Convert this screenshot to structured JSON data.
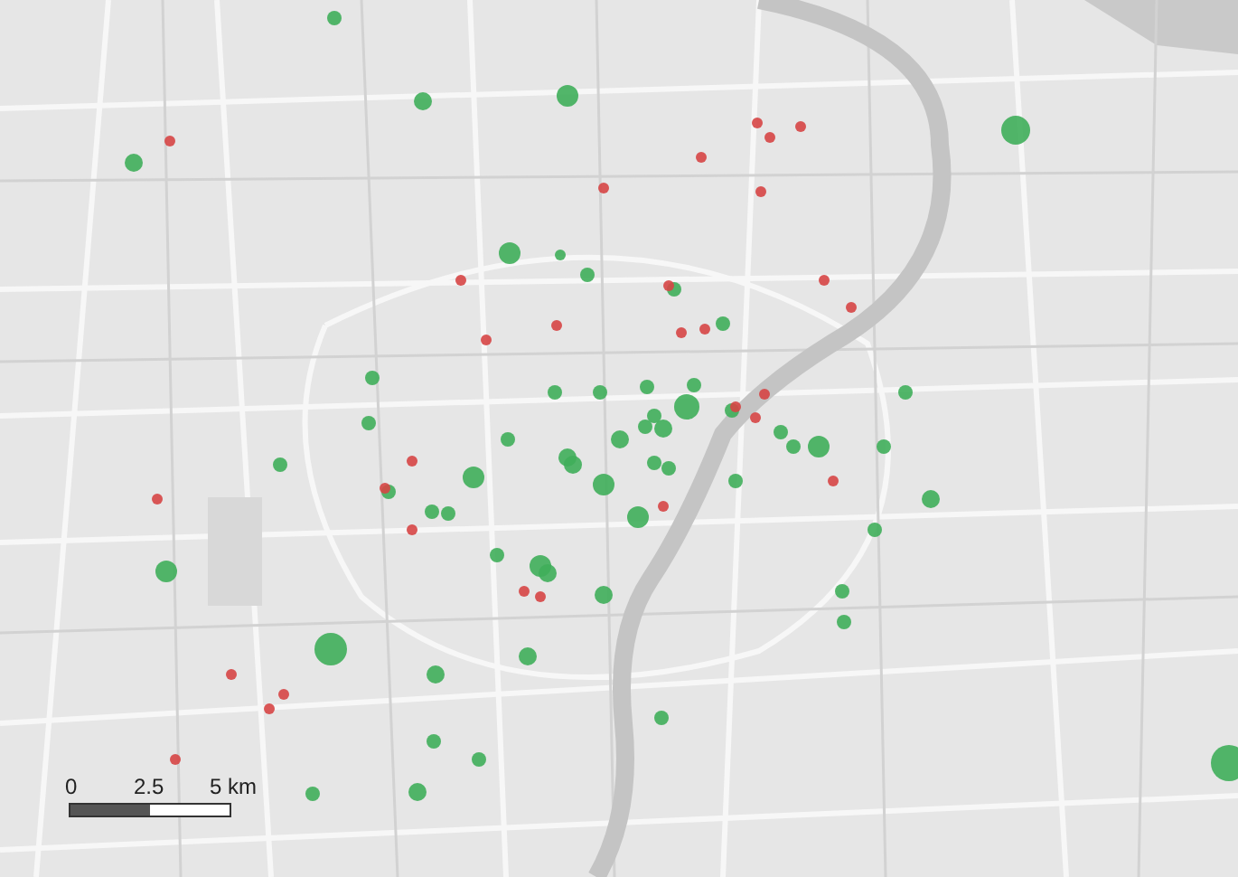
{
  "scale_bar": {
    "labels": [
      "0",
      "2.5",
      "5 km"
    ]
  }
}
